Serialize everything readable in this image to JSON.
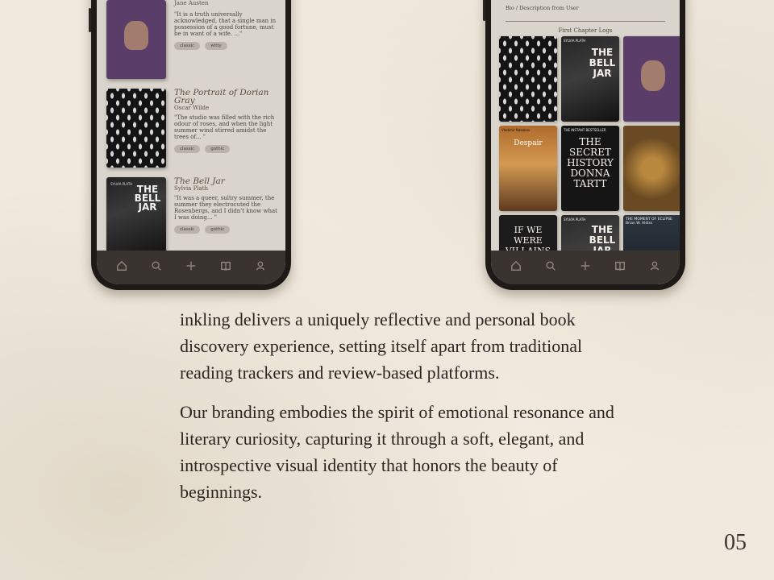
{
  "left_phone": {
    "books": [
      {
        "author_top": "Jane Austen",
        "quote": "\"It is a truth universally acknowledged, that a single man in possession of a good fortune, must be in want of a wife. ...\"",
        "tags": [
          "classic",
          "witty"
        ]
      },
      {
        "title": "The Portrait of Dorian Gray",
        "author": "Oscar Wilde",
        "quote": "\"The studio was filled with the rich odour of roses, and when the light summer wind stirred amidst the trees of... \"",
        "tags": [
          "classic",
          "gothic"
        ]
      },
      {
        "title": "The Bell Jar",
        "author": "Sylvia Plath",
        "cover_author": "SYLVIA PLATH",
        "cover_title": "THE BELL JAR",
        "quote": "\"It was a queer, sultry summer, the summer they electrocuted the Rosenbergs, and I didn't know what I was doing... \"",
        "tags": [
          "classic",
          "gothic"
        ]
      }
    ],
    "tabs": [
      "home-icon",
      "search-icon",
      "plus-icon",
      "book-icon",
      "profile-icon"
    ]
  },
  "right_phone": {
    "bio_label": "Bio / Description from User",
    "section_label": "First Chapter Logs",
    "grid": [
      {
        "style": "g-dorian",
        "text": ""
      },
      {
        "style": "g-bell",
        "small": "SYLVIA PLATH",
        "text": "THE BELL JAR"
      },
      {
        "style": "g-purple",
        "text": ""
      },
      {
        "style": "g-despair",
        "small": "Vladimir Nabokov",
        "text": "Despair"
      },
      {
        "style": "g-secret",
        "small": "THE INSTANT BESTSELLER",
        "text": "THE SECRET HISTORY DONNA TARTT"
      },
      {
        "style": "g-gold",
        "text": ""
      },
      {
        "style": "g-villains",
        "text": "IF WE WERE VILLAINS"
      },
      {
        "style": "g-bell2",
        "small": "SYLVIA PLATH",
        "text": "THE BELL JAR"
      },
      {
        "style": "g-eclipse",
        "small": "THE MOMENT OF ECLIPSE Brian W. Aldiss",
        "text": ""
      }
    ],
    "tabs": [
      "home-icon",
      "search-icon",
      "plus-icon",
      "book-icon",
      "profile-icon"
    ]
  },
  "copy": {
    "p1": "inkling delivers a uniquely reflective and personal book discovery experience, setting itself apart from traditional reading trackers and review-based platforms.",
    "p2": "Our branding embodies the spirit of emotional resonance and literary curiosity, capturing it through a soft, elegant, and introspective visual identity that honors the beauty of beginnings."
  },
  "page_number": "05"
}
